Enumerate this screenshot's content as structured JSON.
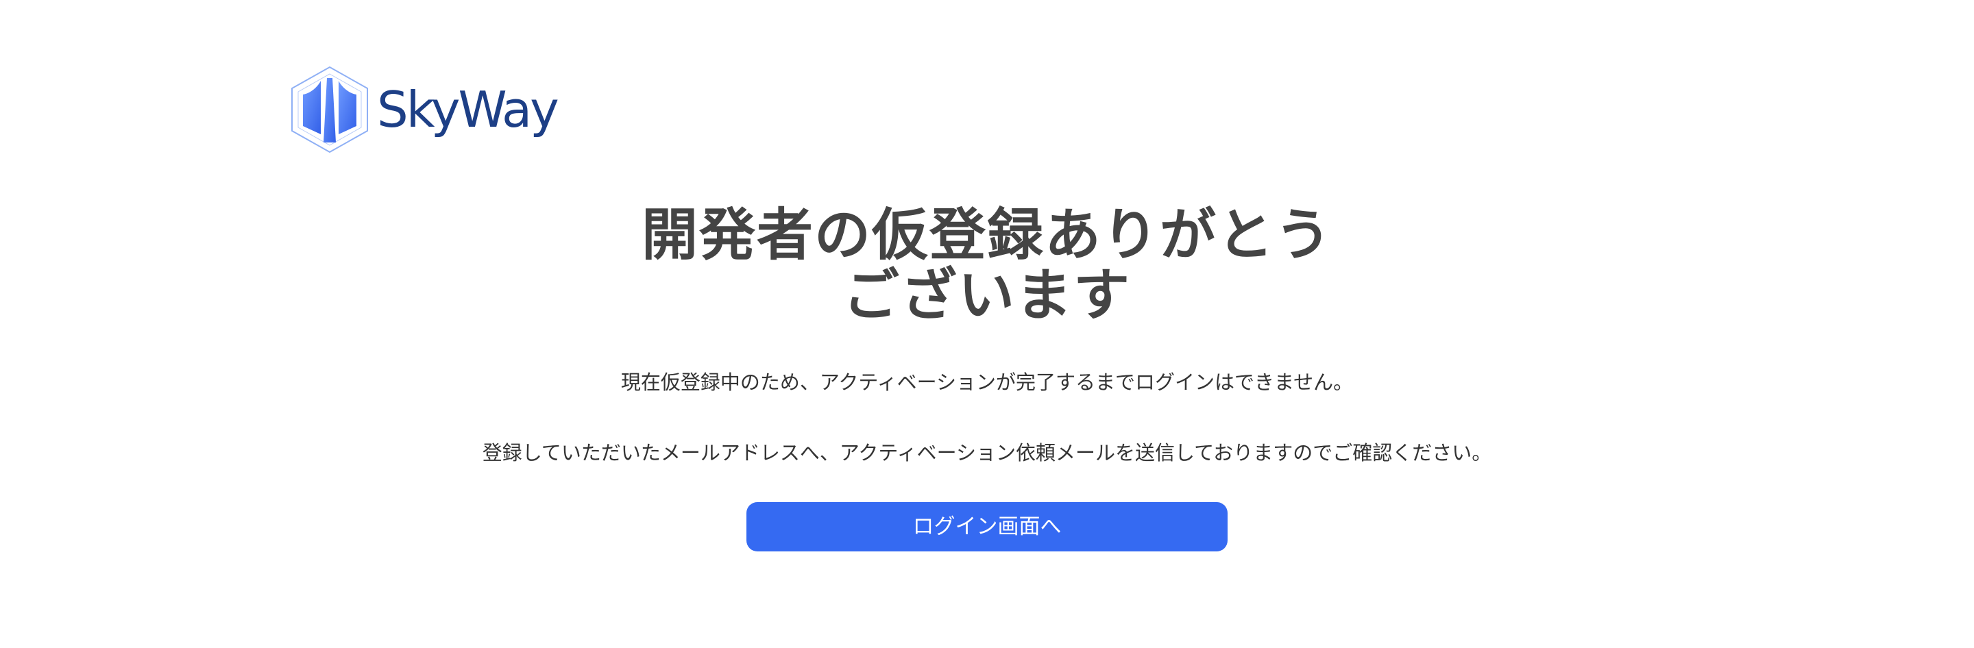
{
  "logo": {
    "text": "SkyWay",
    "icon": "skyway-hexagon-logo-icon",
    "text_color": "#1d3f86",
    "icon_color": "#4a7bf0"
  },
  "main": {
    "title_line1": "開発者の仮登録ありがとう",
    "title_line2": "ございます",
    "message1": "現在仮登録中のため、アクティベーションが完了するまでログインはできません。",
    "message2": "登録していただいたメールアドレスへ、アクティベーション依頼メールを送信しておりますのでご確認ください。",
    "login_button_label": "ログイン画面へ"
  },
  "colors": {
    "button_bg": "#356af2",
    "title_text": "#444444",
    "body_text": "#333333"
  }
}
